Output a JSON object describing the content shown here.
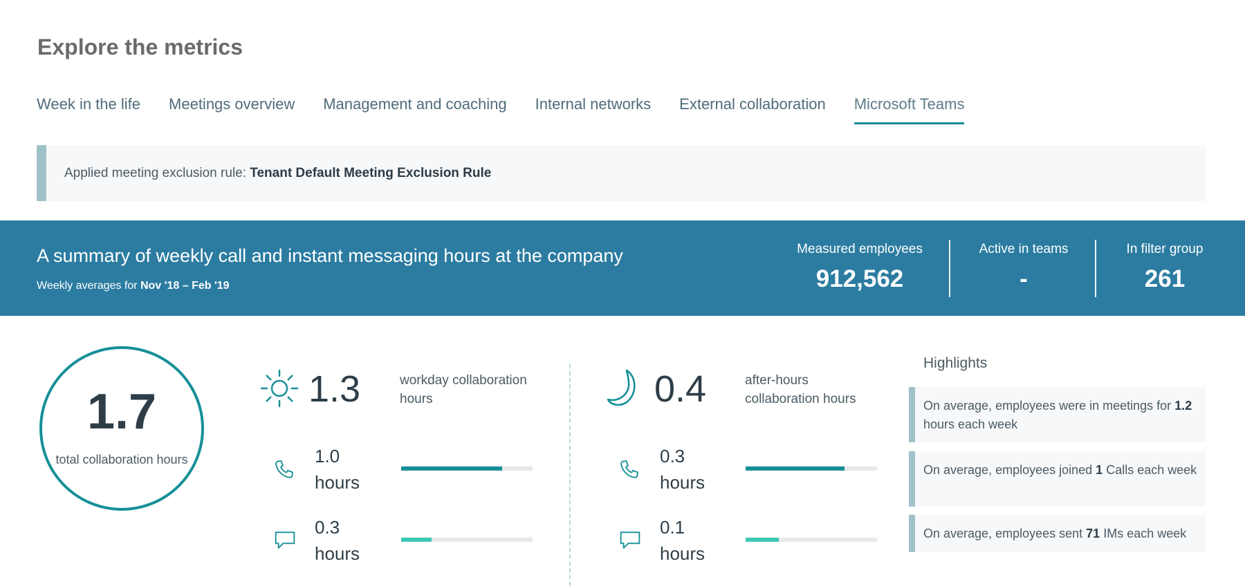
{
  "page_title": "Explore the metrics",
  "tabs": [
    {
      "label": "Week in the life",
      "active": false
    },
    {
      "label": "Meetings overview",
      "active": false
    },
    {
      "label": "Management and coaching",
      "active": false
    },
    {
      "label": "Internal networks",
      "active": false
    },
    {
      "label": "External collaboration",
      "active": false
    },
    {
      "label": "Microsoft Teams",
      "active": true
    }
  ],
  "rule_banner": {
    "prefix": "Applied meeting exclusion rule:",
    "rule_name": "Tenant Default Meeting Exclusion Rule"
  },
  "summary": {
    "title": "A summary of weekly call and instant messaging hours at the company",
    "subtitle_prefix": "Weekly averages for",
    "date_range": "Nov '18 – Feb '19",
    "stats": [
      {
        "label": "Measured employees",
        "value": "912,562"
      },
      {
        "label": "Active in teams",
        "value": "-"
      },
      {
        "label": "In filter group",
        "value": "261"
      }
    ]
  },
  "total": {
    "value": "1.7",
    "label": "total collaboration hours"
  },
  "workday": {
    "icon": "sun-icon",
    "value": "1.3",
    "label_line1": "workday collaboration",
    "label_line2": "hours",
    "calls": {
      "value": "1.0",
      "unit": "hours",
      "fraction": 0.77,
      "icon": "phone-icon"
    },
    "ims": {
      "value": "0.3",
      "unit": "hours",
      "fraction": 0.23,
      "icon": "chat-icon"
    }
  },
  "after_hours": {
    "icon": "moon-icon",
    "value": "0.4",
    "label_line1": "after-hours",
    "label_line2": "collaboration hours",
    "calls": {
      "value": "0.3",
      "unit": "hours",
      "fraction": 0.75,
      "icon": "phone-icon"
    },
    "ims": {
      "value": "0.1",
      "unit": "hours",
      "fraction": 0.25,
      "icon": "chat-icon"
    }
  },
  "highlights": {
    "title": "Highlights",
    "items": [
      {
        "pre": "On average, employees were in meetings for",
        "value": "1.2",
        "post": "hours each week"
      },
      {
        "pre": "On average, employees joined",
        "value": "1",
        "post": "Calls each week"
      },
      {
        "pre": "On average, employees sent",
        "value": "71",
        "post": "IMs each week"
      }
    ]
  },
  "colors": {
    "accent": "#168f98",
    "banner_bg": "#2c7ca1",
    "bar_calls": "#168f98",
    "bar_ims": "#3cc8b4",
    "highlight_border": "#9fc2c8"
  }
}
